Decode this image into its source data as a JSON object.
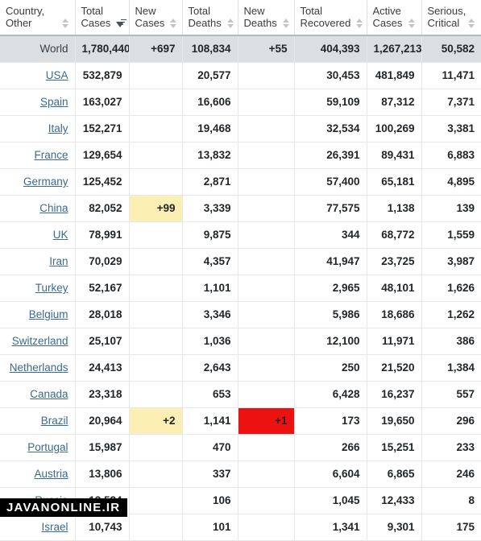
{
  "table": {
    "columns": [
      {
        "id": "country",
        "line1": "Country,",
        "line2": "Other",
        "sort_state": "none"
      },
      {
        "id": "total_cases",
        "line1": "Total",
        "line2": "Cases",
        "sort_state": "desc"
      },
      {
        "id": "new_cases",
        "line1": "New",
        "line2": "Cases",
        "sort_state": "none"
      },
      {
        "id": "total_deaths",
        "line1": "Total",
        "line2": "Deaths",
        "sort_state": "none"
      },
      {
        "id": "new_deaths",
        "line1": "New",
        "line2": "Deaths",
        "sort_state": "none"
      },
      {
        "id": "total_recov",
        "line1": "Total",
        "line2": "Recovered",
        "sort_state": "none"
      },
      {
        "id": "active_cases",
        "line1": "Active",
        "line2": "Cases",
        "sort_state": "none"
      },
      {
        "id": "serious",
        "line1": "Serious,",
        "line2": "Critical",
        "sort_state": "none"
      }
    ],
    "rows": [
      {
        "country": "World",
        "is_world": true,
        "total_cases": "1,780,440",
        "new_cases": "+697",
        "total_deaths": "108,834",
        "new_deaths": "+55",
        "total_recovered": "404,393",
        "active_cases": "1,267,213",
        "serious_critical": "50,582",
        "new_cases_highlight": "none",
        "new_deaths_highlight": "none"
      },
      {
        "country": "USA",
        "is_world": false,
        "total_cases": "532,879",
        "new_cases": "",
        "total_deaths": "20,577",
        "new_deaths": "",
        "total_recovered": "30,453",
        "active_cases": "481,849",
        "serious_critical": "11,471",
        "new_cases_highlight": "none",
        "new_deaths_highlight": "none"
      },
      {
        "country": "Spain",
        "is_world": false,
        "total_cases": "163,027",
        "new_cases": "",
        "total_deaths": "16,606",
        "new_deaths": "",
        "total_recovered": "59,109",
        "active_cases": "87,312",
        "serious_critical": "7,371",
        "new_cases_highlight": "none",
        "new_deaths_highlight": "none"
      },
      {
        "country": "Italy",
        "is_world": false,
        "total_cases": "152,271",
        "new_cases": "",
        "total_deaths": "19,468",
        "new_deaths": "",
        "total_recovered": "32,534",
        "active_cases": "100,269",
        "serious_critical": "3,381",
        "new_cases_highlight": "none",
        "new_deaths_highlight": "none"
      },
      {
        "country": "France",
        "is_world": false,
        "total_cases": "129,654",
        "new_cases": "",
        "total_deaths": "13,832",
        "new_deaths": "",
        "total_recovered": "26,391",
        "active_cases": "89,431",
        "serious_critical": "6,883",
        "new_cases_highlight": "none",
        "new_deaths_highlight": "none"
      },
      {
        "country": "Germany",
        "is_world": false,
        "total_cases": "125,452",
        "new_cases": "",
        "total_deaths": "2,871",
        "new_deaths": "",
        "total_recovered": "57,400",
        "active_cases": "65,181",
        "serious_critical": "4,895",
        "new_cases_highlight": "none",
        "new_deaths_highlight": "none"
      },
      {
        "country": "China",
        "is_world": false,
        "total_cases": "82,052",
        "new_cases": "+99",
        "total_deaths": "3,339",
        "new_deaths": "",
        "total_recovered": "77,575",
        "active_cases": "1,138",
        "serious_critical": "139",
        "new_cases_highlight": "yellow",
        "new_deaths_highlight": "none"
      },
      {
        "country": "UK",
        "is_world": false,
        "total_cases": "78,991",
        "new_cases": "",
        "total_deaths": "9,875",
        "new_deaths": "",
        "total_recovered": "344",
        "active_cases": "68,772",
        "serious_critical": "1,559",
        "new_cases_highlight": "none",
        "new_deaths_highlight": "none"
      },
      {
        "country": "Iran",
        "is_world": false,
        "total_cases": "70,029",
        "new_cases": "",
        "total_deaths": "4,357",
        "new_deaths": "",
        "total_recovered": "41,947",
        "active_cases": "23,725",
        "serious_critical": "3,987",
        "new_cases_highlight": "none",
        "new_deaths_highlight": "none"
      },
      {
        "country": "Turkey",
        "is_world": false,
        "total_cases": "52,167",
        "new_cases": "",
        "total_deaths": "1,101",
        "new_deaths": "",
        "total_recovered": "2,965",
        "active_cases": "48,101",
        "serious_critical": "1,626",
        "new_cases_highlight": "none",
        "new_deaths_highlight": "none"
      },
      {
        "country": "Belgium",
        "is_world": false,
        "total_cases": "28,018",
        "new_cases": "",
        "total_deaths": "3,346",
        "new_deaths": "",
        "total_recovered": "5,986",
        "active_cases": "18,686",
        "serious_critical": "1,262",
        "new_cases_highlight": "none",
        "new_deaths_highlight": "none"
      },
      {
        "country": "Switzerland",
        "is_world": false,
        "total_cases": "25,107",
        "new_cases": "",
        "total_deaths": "1,036",
        "new_deaths": "",
        "total_recovered": "12,100",
        "active_cases": "11,971",
        "serious_critical": "386",
        "new_cases_highlight": "none",
        "new_deaths_highlight": "none"
      },
      {
        "country": "Netherlands",
        "is_world": false,
        "total_cases": "24,413",
        "new_cases": "",
        "total_deaths": "2,643",
        "new_deaths": "",
        "total_recovered": "250",
        "active_cases": "21,520",
        "serious_critical": "1,384",
        "new_cases_highlight": "none",
        "new_deaths_highlight": "none"
      },
      {
        "country": "Canada",
        "is_world": false,
        "total_cases": "23,318",
        "new_cases": "",
        "total_deaths": "653",
        "new_deaths": "",
        "total_recovered": "6,428",
        "active_cases": "16,237",
        "serious_critical": "557",
        "new_cases_highlight": "none",
        "new_deaths_highlight": "none"
      },
      {
        "country": "Brazil",
        "is_world": false,
        "total_cases": "20,964",
        "new_cases": "+2",
        "total_deaths": "1,141",
        "new_deaths": "+1",
        "total_recovered": "173",
        "active_cases": "19,650",
        "serious_critical": "296",
        "new_cases_highlight": "yellow",
        "new_deaths_highlight": "red"
      },
      {
        "country": "Portugal",
        "is_world": false,
        "total_cases": "15,987",
        "new_cases": "",
        "total_deaths": "470",
        "new_deaths": "",
        "total_recovered": "266",
        "active_cases": "15,251",
        "serious_critical": "233",
        "new_cases_highlight": "none",
        "new_deaths_highlight": "none"
      },
      {
        "country": "Austria",
        "is_world": false,
        "total_cases": "13,806",
        "new_cases": "",
        "total_deaths": "337",
        "new_deaths": "",
        "total_recovered": "6,604",
        "active_cases": "6,865",
        "serious_critical": "246",
        "new_cases_highlight": "none",
        "new_deaths_highlight": "none"
      },
      {
        "country": "Russia",
        "is_world": false,
        "total_cases": "13,584",
        "new_cases": "",
        "total_deaths": "106",
        "new_deaths": "",
        "total_recovered": "1,045",
        "active_cases": "12,433",
        "serious_critical": "8",
        "new_cases_highlight": "none",
        "new_deaths_highlight": "none"
      },
      {
        "country": "Israel",
        "is_world": false,
        "total_cases": "10,743",
        "new_cases": "",
        "total_deaths": "101",
        "new_deaths": "",
        "total_recovered": "1,341",
        "active_cases": "9,301",
        "serious_critical": "175",
        "new_cases_highlight": "none",
        "new_deaths_highlight": "none"
      }
    ]
  },
  "watermark": {
    "text": "JAVANONLINE.IR"
  },
  "colors": {
    "highlight_yellow": "#fcefb4",
    "highlight_red": "#ed1212",
    "world_row_bg": "#dcdfe1",
    "link": "#3a6a8e",
    "header_rule": "#b4b9be"
  }
}
